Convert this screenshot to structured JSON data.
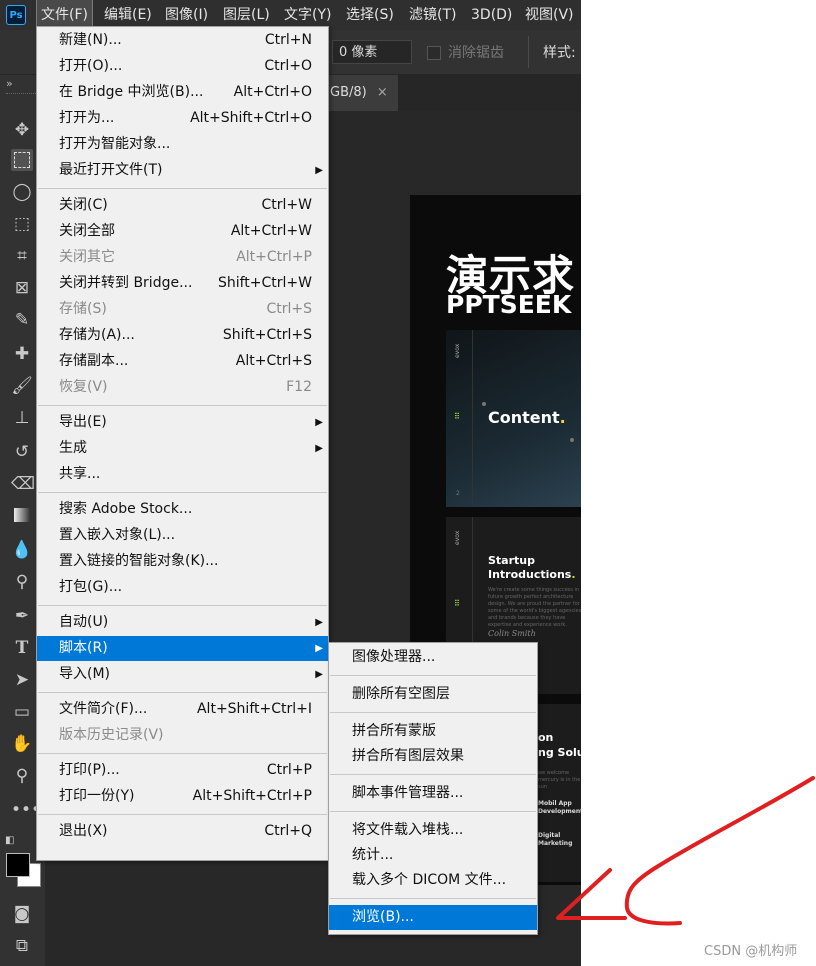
{
  "menubar": {
    "logo": "Ps",
    "items": [
      "文件(F)",
      "编辑(E)",
      "图像(I)",
      "图层(L)",
      "文字(Y)",
      "选择(S)",
      "滤镜(T)",
      "3D(D)",
      "视图(V)"
    ]
  },
  "options": {
    "feather_value": "0 像素",
    "antialias_label": "消除锯齿",
    "style_label": "样式:"
  },
  "document_tab": {
    "label": "GB/8)",
    "close": "×"
  },
  "toolbar": {
    "collapse": "»",
    "tools": [
      "move-tool",
      "marquee-tool",
      "lasso-tool",
      "object-select-tool",
      "crop-tool",
      "frame-tool",
      "eyedropper-tool",
      "healing-tool",
      "brush-tool",
      "stamp-tool",
      "history-brush-tool",
      "eraser-tool",
      "gradient-tool",
      "blur-tool",
      "dodge-tool",
      "pen-tool",
      "type-tool",
      "path-select-tool",
      "rectangle-tool",
      "hand-tool",
      "zoom-tool",
      "more-tools"
    ],
    "colors": {
      "foreground": "#000000",
      "background": "#ffffff"
    }
  },
  "canvas": {
    "title": "演示求",
    "subtitle": "PPTSEEK",
    "slide1": {
      "brand": "evox",
      "title": "Content",
      "dot": ".",
      "page": "2"
    },
    "slide2": {
      "brand": "evox",
      "title_line1": "Startup",
      "title_line2": "Introductions",
      "dot": ".",
      "text": "We're create some things success in future growth perfect architecture design. We are proud the partner for some of the world's biggest agencies and brands because they have expertise and experience work.",
      "signature": "Colin Smith"
    },
    "slide3": {
      "title_line1": "on",
      "title_line2": "ng Solut",
      "text": "we welcome mercury is in the sun",
      "item1_line1": "Mobil App",
      "item1_line2": "Development",
      "item2_line1": "Digital",
      "item2_line2": "Marketing"
    }
  },
  "file_menu": {
    "groups": [
      [
        {
          "label": "新建(N)...",
          "shortcut": "Ctrl+N"
        },
        {
          "label": "打开(O)...",
          "shortcut": "Ctrl+O"
        },
        {
          "label": "在 Bridge 中浏览(B)...",
          "shortcut": "Alt+Ctrl+O"
        },
        {
          "label": "打开为...",
          "shortcut": "Alt+Shift+Ctrl+O"
        },
        {
          "label": "打开为智能对象...",
          "shortcut": ""
        },
        {
          "label": "最近打开文件(T)",
          "shortcut": "",
          "submenu": true
        }
      ],
      [
        {
          "label": "关闭(C)",
          "shortcut": "Ctrl+W"
        },
        {
          "label": "关闭全部",
          "shortcut": "Alt+Ctrl+W"
        },
        {
          "label": "关闭其它",
          "shortcut": "Alt+Ctrl+P",
          "disabled": true
        },
        {
          "label": "关闭并转到 Bridge...",
          "shortcut": "Shift+Ctrl+W"
        },
        {
          "label": "存储(S)",
          "shortcut": "Ctrl+S",
          "disabled": true
        },
        {
          "label": "存储为(A)...",
          "shortcut": "Shift+Ctrl+S"
        },
        {
          "label": "存储副本...",
          "shortcut": "Alt+Ctrl+S"
        },
        {
          "label": "恢复(V)",
          "shortcut": "F12",
          "disabled": true
        }
      ],
      [
        {
          "label": "导出(E)",
          "shortcut": "",
          "submenu": true
        },
        {
          "label": "生成",
          "shortcut": "",
          "submenu": true
        },
        {
          "label": "共享...",
          "shortcut": ""
        }
      ],
      [
        {
          "label": "搜索 Adobe Stock...",
          "shortcut": ""
        },
        {
          "label": "置入嵌入对象(L)...",
          "shortcut": ""
        },
        {
          "label": "置入链接的智能对象(K)...",
          "shortcut": ""
        },
        {
          "label": "打包(G)...",
          "shortcut": ""
        }
      ],
      [
        {
          "label": "自动(U)",
          "shortcut": "",
          "submenu": true
        },
        {
          "label": "脚本(R)",
          "shortcut": "",
          "submenu": true,
          "highlighted": true
        },
        {
          "label": "导入(M)",
          "shortcut": "",
          "submenu": true
        }
      ],
      [
        {
          "label": "文件简介(F)...",
          "shortcut": "Alt+Shift+Ctrl+I"
        },
        {
          "label": "版本历史记录(V)",
          "shortcut": "",
          "disabled": true
        }
      ],
      [
        {
          "label": "打印(P)...",
          "shortcut": "Ctrl+P"
        },
        {
          "label": "打印一份(Y)",
          "shortcut": "Alt+Shift+Ctrl+P"
        }
      ],
      [
        {
          "label": "退出(X)",
          "shortcut": "Ctrl+Q"
        }
      ]
    ]
  },
  "scripts_submenu": {
    "groups": [
      [
        {
          "label": "图像处理器..."
        }
      ],
      [
        {
          "label": "删除所有空图层"
        }
      ],
      [
        {
          "label": "拼合所有蒙版"
        },
        {
          "label": "拼合所有图层效果"
        }
      ],
      [
        {
          "label": "脚本事件管理器..."
        }
      ],
      [
        {
          "label": "将文件载入堆栈..."
        },
        {
          "label": "统计..."
        },
        {
          "label": "载入多个 DICOM 文件..."
        }
      ],
      [
        {
          "label": "浏览(B)...",
          "highlighted": true
        }
      ]
    ]
  },
  "colors": {
    "highlight": "#0078d7",
    "annotation_arrow": "#e02020"
  },
  "watermark": "CSDN @机构师"
}
